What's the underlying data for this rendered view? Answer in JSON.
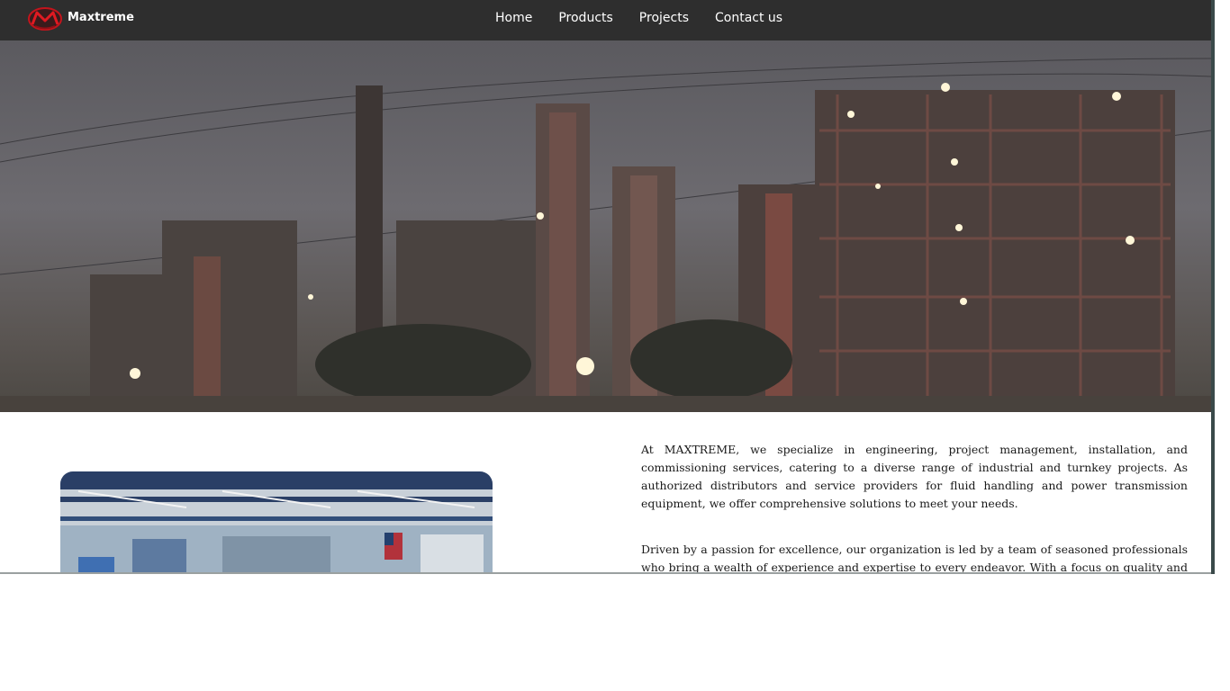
{
  "brand": {
    "name": "Maxtreme",
    "logo_icon": "maxtreme-logo-icon",
    "accent_color": "#c4141c"
  },
  "nav": {
    "background": "#2e2e2e",
    "links": [
      {
        "label": "Home"
      },
      {
        "label": "Products"
      },
      {
        "label": "Projects"
      },
      {
        "label": "Contact us"
      }
    ]
  },
  "hero": {
    "image": "industrial-refinery-night-photo"
  },
  "about": {
    "image": "factory-interior-photo",
    "paragraphs": [
      "At MAXTREME, we specialize in engineering, project management, installation, and commissioning services, catering to a diverse range of industrial and turnkey projects. As authorized distributors and service providers for fluid handling and power transmission equipment, we offer comprehensive solutions to meet your needs.",
      "Driven by a passion for excellence, our organization is led by a team of seasoned professionals who bring a wealth of experience and expertise to every endeavor. With a focus on quality and customer satisfaction, we are committed to delivering exceptional results that exceed expectations."
    ]
  }
}
